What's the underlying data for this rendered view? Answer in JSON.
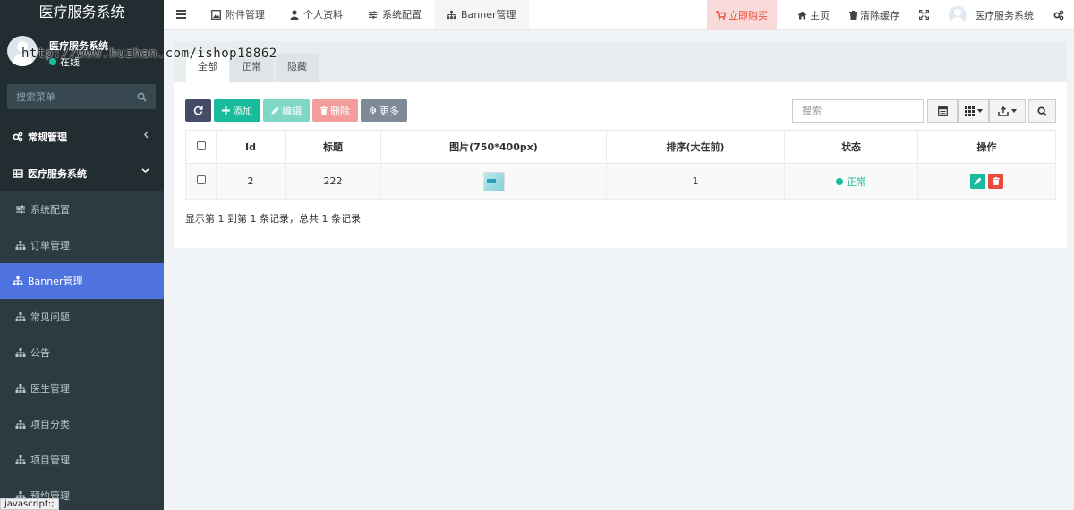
{
  "sidebar": {
    "brand": "医疗服务系统",
    "user_name": "医疗服务系统",
    "user_status": "在线",
    "search_placeholder": "搜索菜单",
    "menu": {
      "general": "常规管理",
      "system": "医疗服务系统",
      "items": [
        "系统配置",
        "订单管理",
        "Banner管理",
        "常见问题",
        "公告",
        "医生管理",
        "项目分类",
        "项目管理",
        "预约管理"
      ]
    }
  },
  "topnav": {
    "tabs": [
      "附件管理",
      "个人资料",
      "系统配置",
      "Banner管理"
    ],
    "buy": "立即购买",
    "home": "主页",
    "clear_cache": "清除缓存",
    "user": "医疗服务系统"
  },
  "panel": {
    "tabs": [
      "全部",
      "正常",
      "隐藏"
    ],
    "toolbar": {
      "add": "添加",
      "edit": "编辑",
      "delete": "删除",
      "more": "更多"
    },
    "search_placeholder": "搜索",
    "columns": [
      "Id",
      "标题",
      "图片(750*400px)",
      "排序(大在前)",
      "状态",
      "操作"
    ],
    "rows": [
      {
        "id": "2",
        "title": "222",
        "sort": "1",
        "status": "正常"
      }
    ],
    "summary": "显示第 1 到第 1 条记录，总共 1 条记录"
  },
  "overlay": {
    "watermark": "http://www.huzhan.com/ishop18862",
    "status_bar": "javascript:;"
  },
  "colors": {
    "sidebar_bg": "#222d32",
    "active": "#4e73df",
    "success": "#18bc9c",
    "danger": "#e74c3c"
  }
}
